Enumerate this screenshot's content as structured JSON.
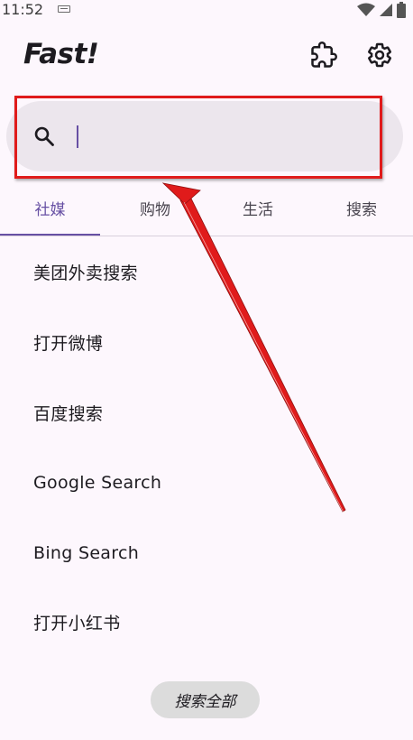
{
  "status_bar": {
    "time": "11:52"
  },
  "app": {
    "title": "Fast!"
  },
  "search": {
    "value": "",
    "placeholder": ""
  },
  "tabs": [
    {
      "label": "社媒",
      "active": true
    },
    {
      "label": "购物",
      "active": false
    },
    {
      "label": "生活",
      "active": false
    },
    {
      "label": "搜索",
      "active": false
    }
  ],
  "actions": [
    {
      "label": "美团外卖搜索"
    },
    {
      "label": "打开微博"
    },
    {
      "label": "百度搜索"
    },
    {
      "label": "Google Search"
    },
    {
      "label": "Bing Search"
    },
    {
      "label": "打开小红书"
    }
  ],
  "bottom": {
    "search_all_label": "搜索全部"
  },
  "annotation": {
    "highlight_color": "#e01b1b"
  },
  "theme": {
    "accent": "#6750a4",
    "background": "#fdf7fd"
  }
}
